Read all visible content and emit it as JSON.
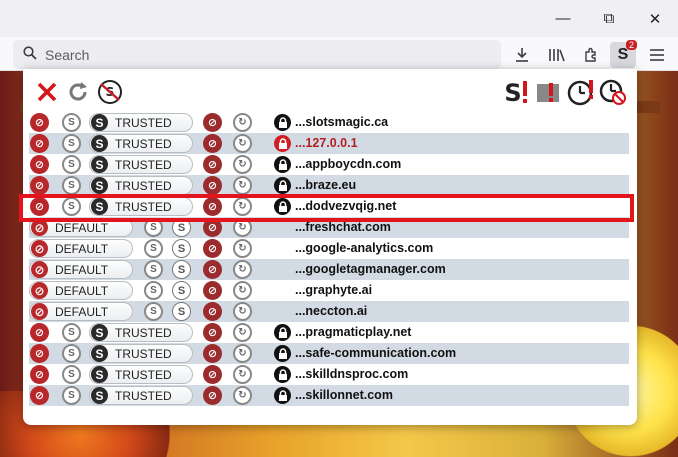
{
  "browser": {
    "search_placeholder": "Search",
    "extension_badge": "2",
    "icons": [
      "search-icon",
      "download-icon",
      "library-icon",
      "extensions-icon",
      "noscript-icon",
      "menu-icon",
      "minimize-icon",
      "maximize-icon",
      "close-window-icon"
    ]
  },
  "popup": {
    "toolbar_icons": [
      "close-icon",
      "reload-icon",
      "options-icon",
      "disable-restrictions-tab-icon",
      "disable-restrictions-globally-icon",
      "temp-trust-page-icon",
      "revoke-temp-icon"
    ],
    "rows": [
      {
        "domain": "...slotsmagic.ca",
        "status": "TRUSTED",
        "locked": true,
        "lock_red": false,
        "domain_red": false
      },
      {
        "domain": "...127.0.0.1",
        "status": "TRUSTED",
        "locked": true,
        "lock_red": true,
        "domain_red": true
      },
      {
        "domain": "...appboycdn.com",
        "status": "TRUSTED",
        "locked": true,
        "lock_red": false,
        "domain_red": false
      },
      {
        "domain": "...braze.eu",
        "status": "TRUSTED",
        "locked": true,
        "lock_red": false,
        "domain_red": false
      },
      {
        "domain": "...dodvezvqig.net",
        "status": "TRUSTED",
        "locked": true,
        "lock_red": false,
        "domain_red": false
      },
      {
        "domain": "...freshchat.com",
        "status": "DEFAULT",
        "locked": false,
        "lock_red": false,
        "domain_red": false
      },
      {
        "domain": "...google-analytics.com",
        "status": "DEFAULT",
        "locked": false,
        "lock_red": false,
        "domain_red": false
      },
      {
        "domain": "...googletagmanager.com",
        "status": "DEFAULT",
        "locked": false,
        "lock_red": false,
        "domain_red": false
      },
      {
        "domain": "...graphyte.ai",
        "status": "DEFAULT",
        "locked": false,
        "lock_red": false,
        "domain_red": false
      },
      {
        "domain": "...neccton.ai",
        "status": "DEFAULT",
        "locked": false,
        "lock_red": false,
        "domain_red": false
      },
      {
        "domain": "...pragmaticplay.net",
        "status": "TRUSTED",
        "locked": true,
        "lock_red": false,
        "domain_red": false
      },
      {
        "domain": "...safe-communication.com",
        "status": "TRUSTED",
        "locked": true,
        "lock_red": false,
        "domain_red": false
      },
      {
        "domain": "...skilldnsproc.com",
        "status": "TRUSTED",
        "locked": true,
        "lock_red": false,
        "domain_red": false
      },
      {
        "domain": "...skillonnet.com",
        "status": "TRUSTED",
        "locked": true,
        "lock_red": false,
        "domain_red": false
      }
    ],
    "highlighted_row_index": 4,
    "colors": {
      "accent_red": "#e3141b",
      "alt_row": "#d2dbe4",
      "trusted_icon": "#b8282b"
    }
  }
}
